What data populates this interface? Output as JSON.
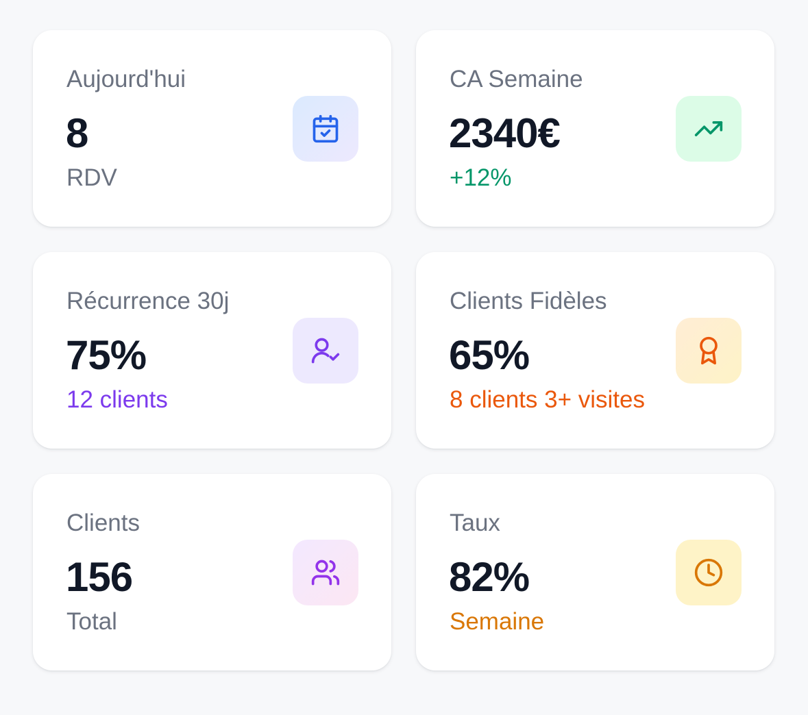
{
  "cards": [
    {
      "label": "Aujourd'hui",
      "value": "8",
      "sub": "RDV",
      "icon": "calendar-check-icon",
      "sub_color": "#6b7280"
    },
    {
      "label": "CA Semaine",
      "value": "2340€",
      "sub": "+12%",
      "icon": "trending-up-icon",
      "sub_color": "#059669"
    },
    {
      "label": "Récurrence 30j",
      "value": "75%",
      "sub": "12 clients",
      "icon": "user-check-icon",
      "sub_color": "#7c3aed"
    },
    {
      "label": "Clients Fidèles",
      "value": "65%",
      "sub": "8 clients 3+ visites",
      "icon": "award-icon",
      "sub_color": "#ea580c"
    },
    {
      "label": "Clients",
      "value": "156",
      "sub": "Total",
      "icon": "users-icon",
      "sub_color": "#6b7280"
    },
    {
      "label": "Taux",
      "value": "82%",
      "sub": "Semaine",
      "icon": "clock-icon",
      "sub_color": "#d97706"
    }
  ]
}
